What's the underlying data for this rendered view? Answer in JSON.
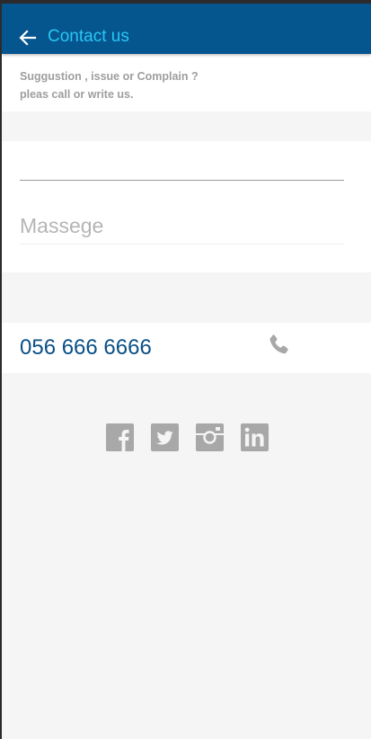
{
  "appbar": {
    "title": "Contact us",
    "back_icon": "arrow-left-icon",
    "background": "#05558f",
    "title_color": "#29c7f2"
  },
  "intro": {
    "line1": "Suggustion , issue or Complain ?",
    "line2": "pleas call or write us."
  },
  "form": {
    "first_field_value": "",
    "message_placeholder": "Massege"
  },
  "contact": {
    "phone": "056 666 6666",
    "phone_icon": "phone-icon",
    "phone_color": "#0a4f86"
  },
  "social": [
    {
      "name": "facebook",
      "icon": "facebook-icon"
    },
    {
      "name": "twitter",
      "icon": "twitter-icon"
    },
    {
      "name": "instagram",
      "icon": "instagram-icon"
    },
    {
      "name": "linkedin",
      "icon": "linkedin-icon"
    }
  ],
  "colors": {
    "icon_gray": "#a8a8a8",
    "page_background": "#f5f5f5"
  }
}
